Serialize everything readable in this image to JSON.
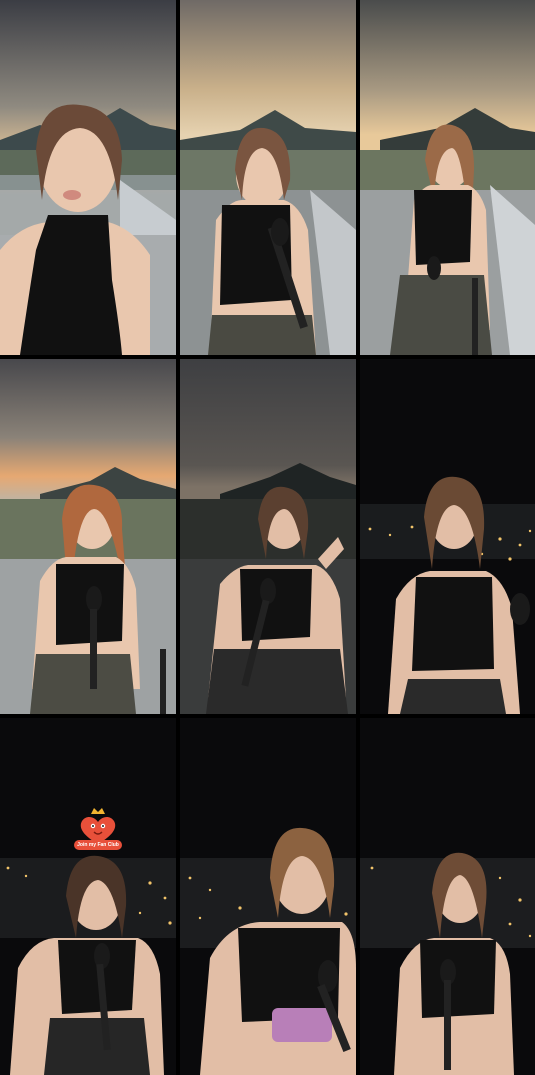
{
  "collage": {
    "tiles": [
      {
        "scene": "dusk-rooftop",
        "pose": "pout"
      },
      {
        "scene": "dusk-rooftop",
        "pose": "mic-stand"
      },
      {
        "scene": "dusk-rooftop",
        "pose": "smile-mic"
      },
      {
        "scene": "dusk-rooftop",
        "pose": "singing"
      },
      {
        "scene": "twilight-rooftop",
        "pose": "hand-gesture"
      },
      {
        "scene": "night-city",
        "pose": "looking-down"
      },
      {
        "scene": "night-city",
        "pose": "singing-badge"
      },
      {
        "scene": "night-city",
        "pose": "holding-phone"
      },
      {
        "scene": "night-city",
        "pose": "singing"
      }
    ]
  },
  "fan_club_badge": {
    "label": "Join my Fan Club",
    "accent": "#e8503a",
    "icon": "heart-mascot-icon"
  },
  "colors": {
    "dusk_sky": "#c9b08a",
    "night_sky": "#0a0a0c",
    "outfit": "#111111",
    "skin": "#e9c7ae"
  }
}
